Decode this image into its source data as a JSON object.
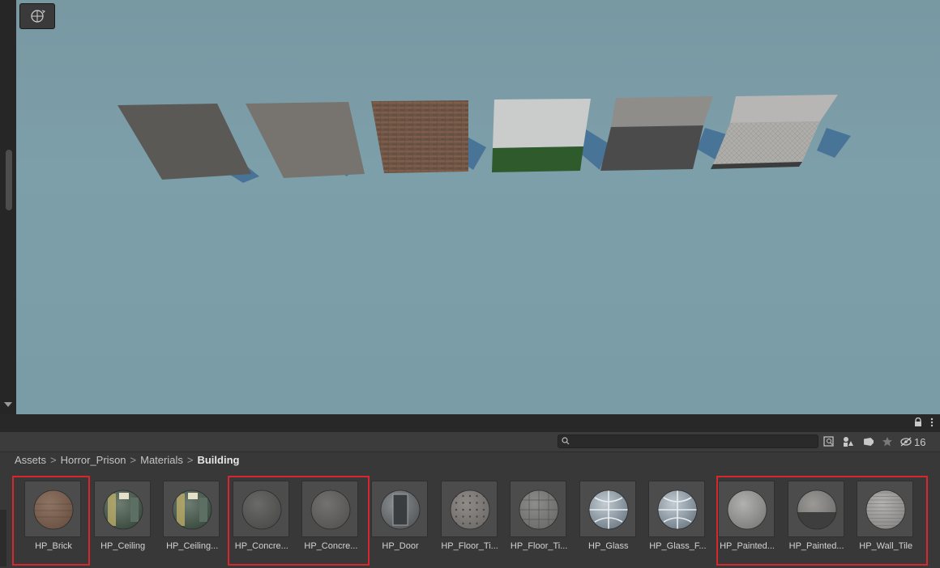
{
  "scene": {
    "gizmo_icon": "camera-orbit-icon",
    "planes": [
      {
        "name": "dark-concrete",
        "color": "#5a5855"
      },
      {
        "name": "light-concrete",
        "color": "#777370"
      },
      {
        "name": "brick",
        "color": "#6f5546"
      },
      {
        "name": "painted-green-white",
        "top": "#c9ccca",
        "bottom": "#2e5a2c"
      },
      {
        "name": "painted-grey",
        "top": "#8c8a86",
        "bottom": "#4a4a4a"
      },
      {
        "name": "wall-tile",
        "top": "#b4b4b2",
        "bottom": "#a7a6a3"
      }
    ]
  },
  "panel": {
    "menu": {
      "lock_icon": "lock-icon",
      "more_icon": "kebab-icon"
    },
    "search": {
      "placeholder": "",
      "icon": "search-icon"
    },
    "toolbar": {
      "icons": [
        "search-filter-icon",
        "type-filter-icon",
        "label-filter-icon",
        "favorite-icon"
      ],
      "hidden_count": "16"
    },
    "breadcrumb": {
      "items": [
        "Assets",
        "Horror_Prison",
        "Materials"
      ],
      "current": "Building",
      "separator": ">"
    },
    "assets": [
      {
        "label": "HP_Brick",
        "kind": "brick"
      },
      {
        "label": "HP_Ceiling",
        "kind": "ceiling"
      },
      {
        "label": "HP_Ceiling...",
        "kind": "ceiling"
      },
      {
        "label": "HP_Concre...",
        "kind": "concrete"
      },
      {
        "label": "HP_Concre...",
        "kind": "concrete2"
      },
      {
        "label": "HP_Door",
        "kind": "door"
      },
      {
        "label": "HP_Floor_Ti...",
        "kind": "floor-dots"
      },
      {
        "label": "HP_Floor_Ti...",
        "kind": "floor-grid"
      },
      {
        "label": "HP_Glass",
        "kind": "glass"
      },
      {
        "label": "HP_Glass_F...",
        "kind": "glass"
      },
      {
        "label": "HP_Painted...",
        "kind": "painted"
      },
      {
        "label": "HP_Painted...",
        "kind": "painted2"
      },
      {
        "label": "HP_Wall_Tile",
        "kind": "tile"
      }
    ],
    "highlight_color": "#d8262d"
  }
}
